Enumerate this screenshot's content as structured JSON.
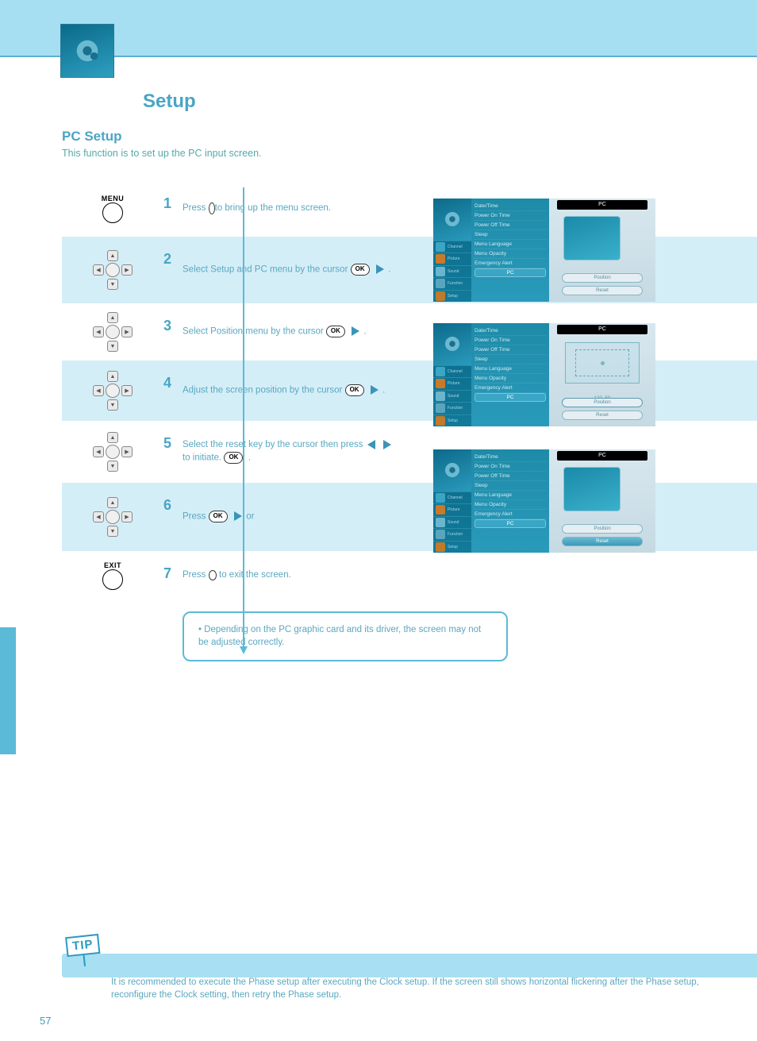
{
  "header": {
    "section_title": "Setup"
  },
  "page": {
    "number": "57",
    "subtitle": "PC Setup",
    "subdesc": "This function is to set up the PC input screen.",
    "info_box": "• Depending on the PC graphic card and its driver, the screen may not be adjusted correctly.",
    "tip_text": "It is recommended to execute the Phase setup after executing the Clock setup. If the screen still shows horizontal flickering after the Phase setup, reconfigure the Clock setting, then retry the Phase setup."
  },
  "buttons": {
    "menu_label": "MENU",
    "exit_label": "EXIT",
    "ok": "OK"
  },
  "steps": [
    {
      "num": "1",
      "text_a": "Press ",
      "text_b": " to bring up the menu screen."
    },
    {
      "num": "2",
      "text_a": "Select Setup and PC menu by the cursor ",
      "text_b": "."
    },
    {
      "num": "3",
      "text_a": "Select Position menu by the cursor ",
      "text_b": "."
    },
    {
      "num": "4",
      "text_a": "Adjust the screen position by the cursor ",
      "text_b": "."
    },
    {
      "num": "5",
      "text_a": "Select the reset key by the cursor then press ",
      "text_b": " to initiate."
    },
    {
      "num": "6",
      "text_a": "Press ",
      "text_b": " or ",
      "text_c": " to exit the screen."
    }
  ],
  "osd": {
    "side_items": [
      "Channel",
      "Picture",
      "Sound",
      "Function",
      "Setup"
    ],
    "mid_items": [
      "Date/Time",
      "Power On Time",
      "Power Off Time",
      "Sleep",
      "Menu Language",
      "Menu Opacity",
      "Emergency Alert",
      "PC"
    ],
    "right_tab": "PC",
    "right_buttons": {
      "position": "Position",
      "reset": "Reset"
    },
    "coords": "120    -50"
  }
}
